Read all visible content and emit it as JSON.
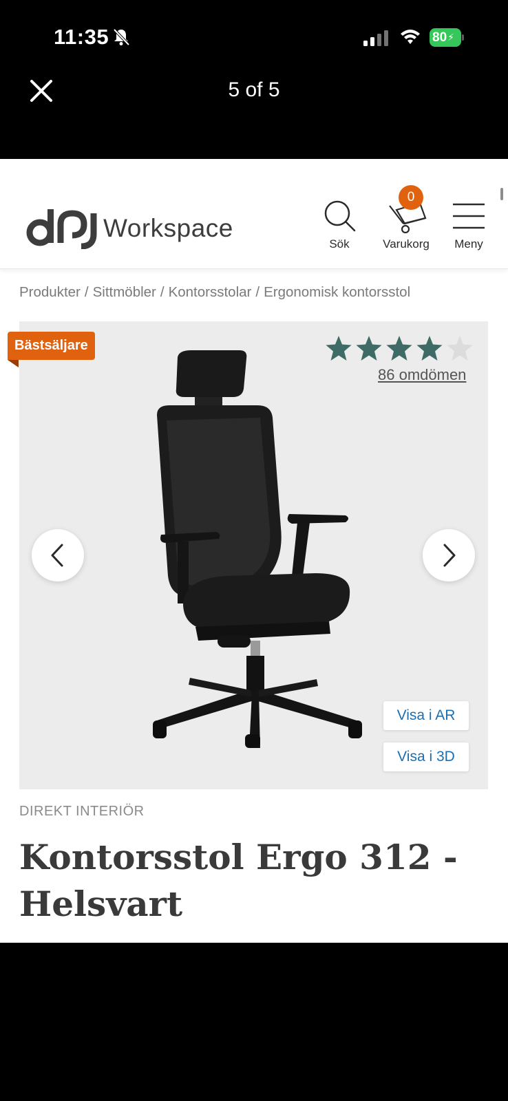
{
  "status_bar": {
    "time": "11:35",
    "battery": "80",
    "battery_color": "#35c759"
  },
  "viewer": {
    "close_icon": "close-icon",
    "counter": "5 of 5"
  },
  "site": {
    "logo_text": "Workspace",
    "actions": {
      "search": "Sök",
      "cart": "Varukorg",
      "cart_count": "0",
      "menu": "Meny"
    },
    "accent_color": "#e0620f"
  },
  "breadcrumb": [
    "Produkter",
    "Sittmöbler",
    "Kontorsstolar",
    "Ergonomisk kontorsstol"
  ],
  "breadcrumb_sep": "/",
  "product": {
    "badge": "Bästsäljare",
    "rating_stars": 4,
    "rating_max": 5,
    "reviews": "86 omdömen",
    "view_ar": "Visa i AR",
    "view_3d": "Visa i 3D",
    "brand": "DIREKT INTERIÖR",
    "title": "Kontorsstol Ergo 312 - Helsvart",
    "star_color": "#3f6b66"
  }
}
